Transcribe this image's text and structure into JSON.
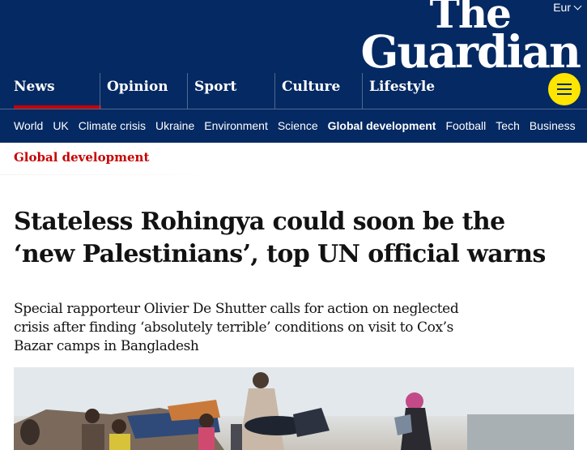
{
  "header": {
    "edition_label": "Eur",
    "logo_line1": "The",
    "logo_line2": "Guardian",
    "brand_color": "#052962",
    "menu_color": "#ffe500"
  },
  "pillars": [
    {
      "label": "News",
      "active": true
    },
    {
      "label": "Opinion",
      "active": false
    },
    {
      "label": "Sport",
      "active": false
    },
    {
      "label": "Culture",
      "active": false
    },
    {
      "label": "Lifestyle",
      "active": false
    }
  ],
  "subnav": [
    {
      "label": "World",
      "active": false
    },
    {
      "label": "UK",
      "active": false
    },
    {
      "label": "Climate crisis",
      "active": false
    },
    {
      "label": "Ukraine",
      "active": false
    },
    {
      "label": "Environment",
      "active": false
    },
    {
      "label": "Science",
      "active": false
    },
    {
      "label": "Global development",
      "active": true
    },
    {
      "label": "Football",
      "active": false
    },
    {
      "label": "Tech",
      "active": false
    },
    {
      "label": "Business",
      "active": false
    }
  ],
  "article": {
    "section": "Global development",
    "section_color": "#c70000",
    "headline": "Stateless Rohingya could soon be the ‘new Palestinians’, top UN official warns",
    "standfirst": "Special rapporteur Olivier De Shutter calls for action on neglected crisis after finding ‘absolutely terrible’ conditions on visit to Cox’s Bazar camps in Bangladesh"
  },
  "icons": {
    "menu": "hamburger-menu-icon",
    "edition": "chevron-down-icon"
  }
}
